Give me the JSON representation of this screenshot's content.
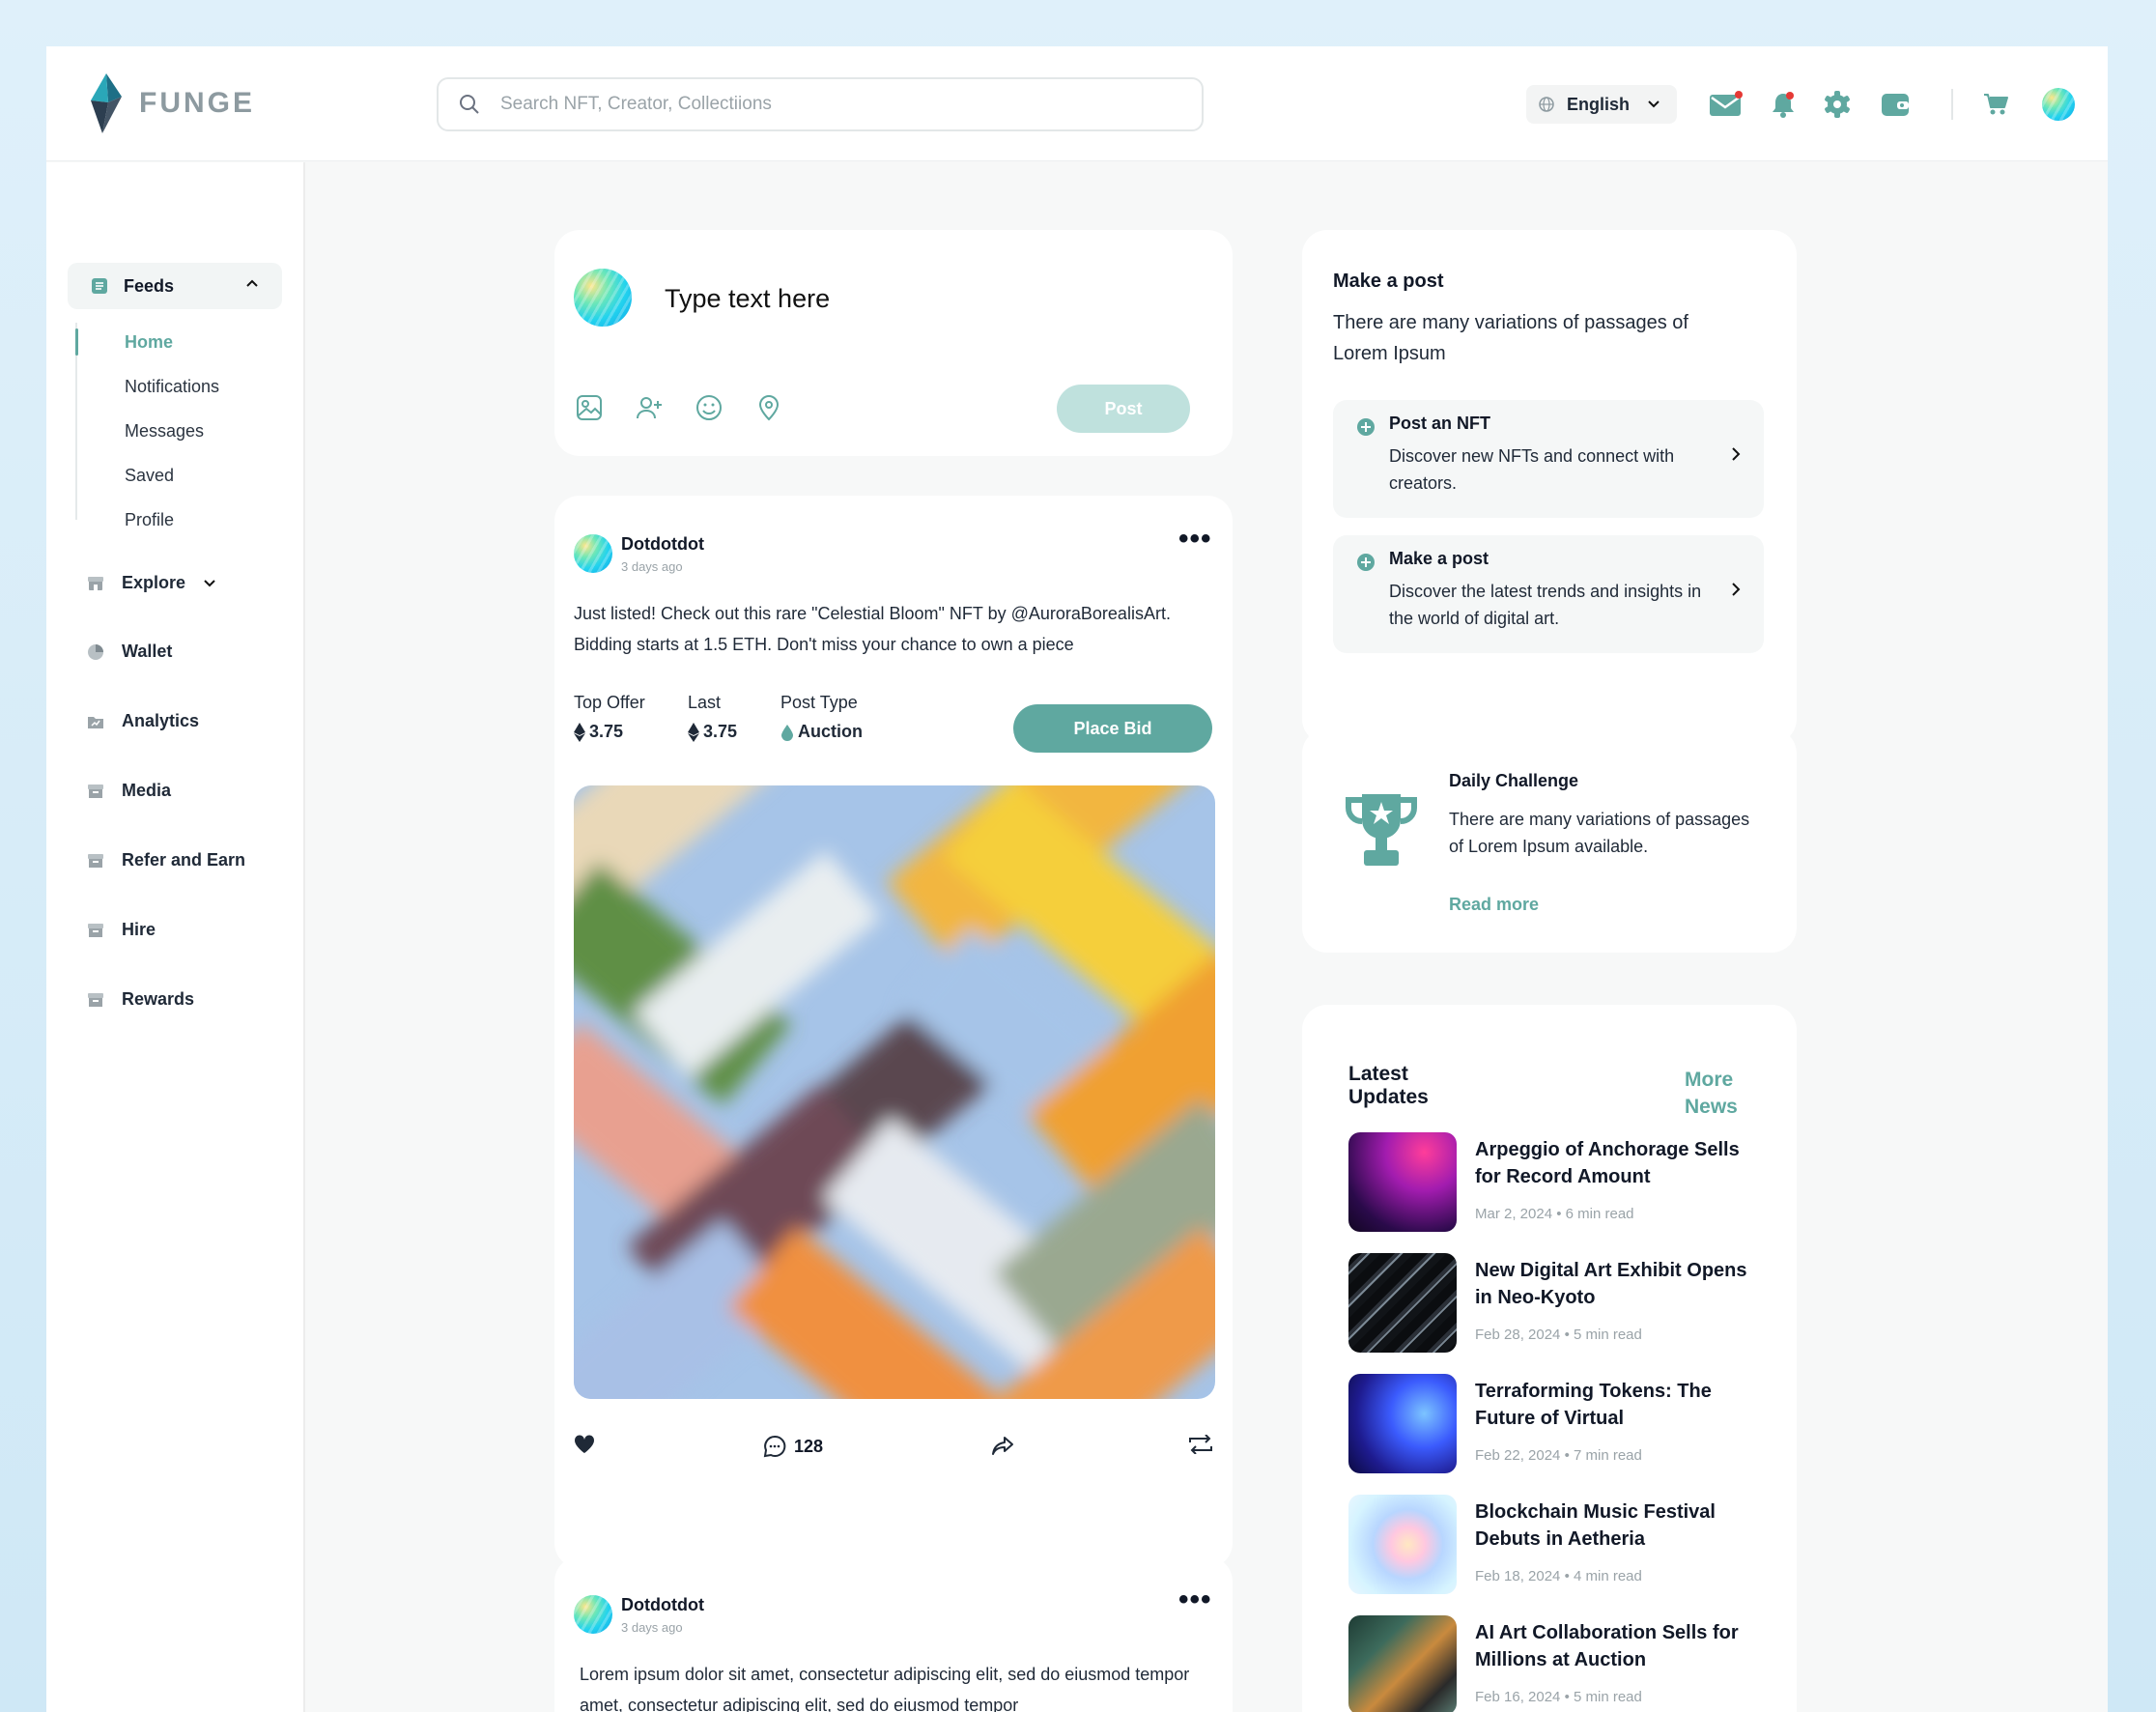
{
  "app": {
    "name": "FUNGE"
  },
  "search": {
    "placeholder": "Search NFT, Creator, Collectiions"
  },
  "header": {
    "language": "English"
  },
  "sidebar": {
    "feeds_label": "Feeds",
    "feeds_sub": [
      "Home",
      "Notifications",
      "Messages",
      "Saved",
      "Profile"
    ],
    "nav": [
      "Explore",
      "Wallet",
      "Analytics",
      "Media",
      "Refer and Earn",
      "Hire",
      "Rewards"
    ]
  },
  "composer": {
    "placeholder": "Type text here",
    "post_label": "Post"
  },
  "post1": {
    "author": "Dotdotdot",
    "time": "3 days ago",
    "text": "Just listed! Check out this rare \"Celestial Bloom\" NFT by @AuroraBorealisArt. Bidding starts at 1.5 ETH. Don't miss your chance to own a piece",
    "top_offer_label": "Top Offer",
    "top_offer_value": "3.75",
    "last_label": "Last",
    "last_value": "3.75",
    "post_type_label": "Post Type",
    "post_type_value": "Auction",
    "bid_label": "Place Bid",
    "comments": "128"
  },
  "post2": {
    "author": "Dotdotdot",
    "time": "3 days ago",
    "text": "Lorem ipsum dolor sit amet, consectetur adipiscing elit, sed do eiusmod tempor amet, consectetur adipiscing elit, sed do eiusmod tempor"
  },
  "make_post": {
    "title": "Make a post",
    "subtitle": "There are many variations of passages of Lorem Ipsum",
    "options": [
      {
        "title": "Post an NFT",
        "desc": "Discover new NFTs and connect with creators."
      },
      {
        "title": "Make a post",
        "desc": "Discover the latest trends and insights in the world of digital art."
      }
    ]
  },
  "challenge": {
    "title": "Daily Challenge",
    "text": "There are many variations of passages of Lorem Ipsum available.",
    "link": "Read more"
  },
  "updates": {
    "title": "Latest Updates",
    "more": "More News",
    "items": [
      {
        "title": "Arpeggio of Anchorage Sells for Record Amount",
        "meta": "Mar 2, 2024 • 6 min read"
      },
      {
        "title": "New Digital Art Exhibit Opens in Neo-Kyoto",
        "meta": "Feb 28, 2024 • 5 min read"
      },
      {
        "title": "Terraforming Tokens: The Future of Virtual",
        "meta": "Feb 22, 2024 • 7 min read"
      },
      {
        "title": "Blockchain Music Festival Debuts in Aetheria",
        "meta": "Feb 18, 2024 • 4 min read"
      },
      {
        "title": "AI Art Collaboration Sells for Millions at Auction",
        "meta": "Feb 16, 2024 • 5 min read"
      }
    ]
  },
  "colors": {
    "accent": "#5fa8a0",
    "post_disabled": "#bfe1dd",
    "background": "#f7f8f8"
  }
}
